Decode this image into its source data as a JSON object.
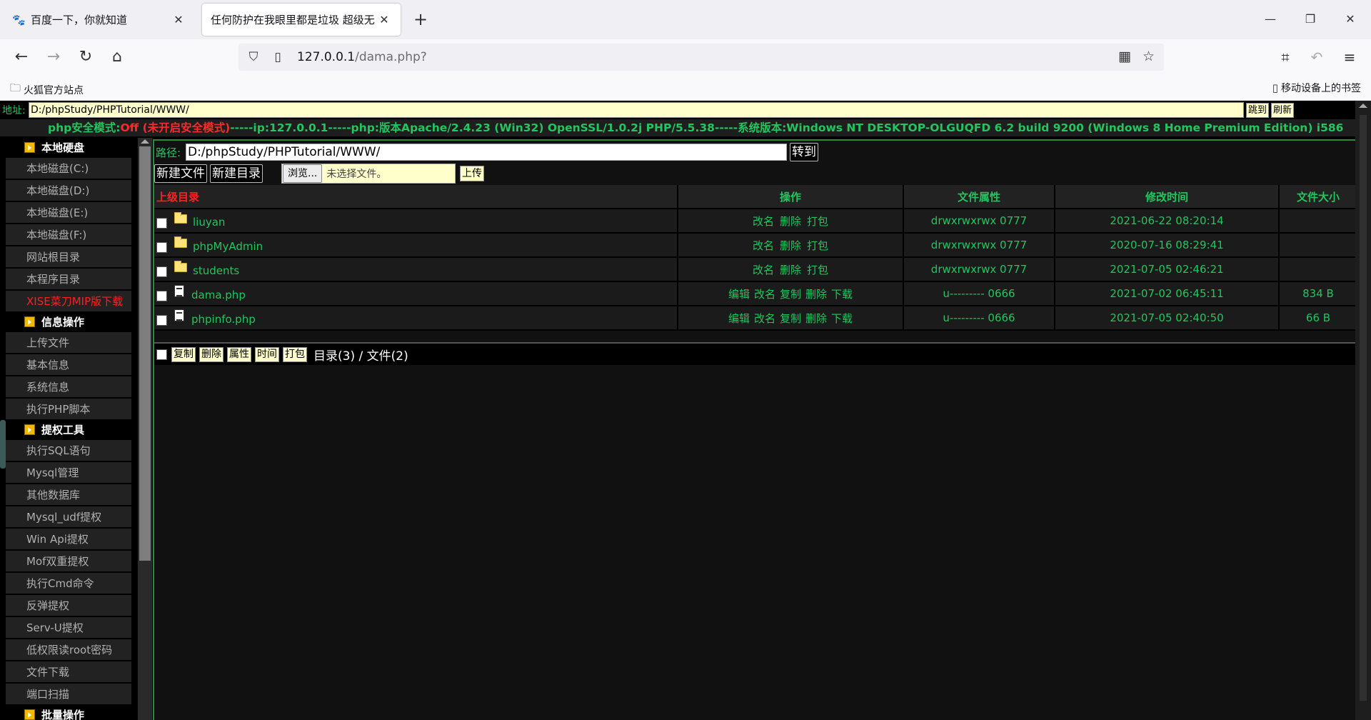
{
  "browser": {
    "tabs": [
      {
        "title": "百度一下，你就知道",
        "close": "✕"
      },
      {
        "title": "任何防护在我眼里都是垃圾 超级无",
        "close": "✕"
      }
    ],
    "new_tab": "+",
    "url_host": "127.0.0.1",
    "url_path": "/dama.php?",
    "bookmark_left": "火狐官方站点",
    "bookmark_right": "移动设备上的书签"
  },
  "page": {
    "addr_label": "地址:",
    "addr_value": "D:/phpStudy/PHPTutorial/WWW/",
    "btn_jump": "跳到",
    "btn_refresh": "刷新",
    "info": {
      "safe_label": "php安全模式:",
      "safe_value": "Off (未开启安全模式)",
      "rest": "-----ip:127.0.0.1-----php:版本Apache/2.4.23 (Win32) OpenSSL/1.0.2j PHP/5.5.38-----系统版本:Windows NT DESKTOP-OLGUQFD 6.2 build 9200 (Windows 8 Home Premium Edition) i586"
    },
    "sidebar": {
      "sections": [
        {
          "title": "本地硬盘",
          "items": [
            "本地磁盘(C:)",
            "本地磁盘(D:)",
            "本地磁盘(E:)",
            "本地磁盘(F:)",
            "网站根目录",
            "本程序目录",
            "XISE菜刀MIP版下载"
          ]
        },
        {
          "title": "信息操作",
          "items": [
            "上传文件",
            "基本信息",
            "系统信息",
            "执行PHP脚本"
          ]
        },
        {
          "title": "提权工具",
          "items": [
            "执行SQL语句",
            "Mysql管理",
            "其他数据库",
            "Mysql_udf提权",
            "Win Api提权",
            "Mof双重提权",
            "执行Cmd命令",
            "反弹提权",
            "Serv-U提权",
            "低权限读root密码",
            "文件下载",
            "端口扫描"
          ]
        },
        {
          "title": "批量操作",
          "items": []
        }
      ]
    },
    "path_label": "路径:",
    "path_value": "D:/phpStudy/PHPTutorial/WWW/",
    "btn_go": "转到",
    "btn_new_file": "新建文件",
    "btn_new_dir": "新建目录",
    "browse": "浏览...",
    "no_file": "未选择文件。",
    "btn_upload": "上传",
    "table": {
      "headers": [
        "上级目录",
        "操作",
        "文件属性",
        "修改时间",
        "文件大小"
      ],
      "rows": [
        {
          "name": "liuyan",
          "type": "dir",
          "ops": [
            "改名",
            "删除",
            "打包"
          ],
          "perm": "drwxrwxrwx 0777",
          "mtime": "2021-06-22 08:20:14",
          "size": ""
        },
        {
          "name": "phpMyAdmin",
          "type": "dir",
          "ops": [
            "改名",
            "删除",
            "打包"
          ],
          "perm": "drwxrwxrwx 0777",
          "mtime": "2020-07-16 08:29:41",
          "size": ""
        },
        {
          "name": "students",
          "type": "dir",
          "ops": [
            "改名",
            "删除",
            "打包"
          ],
          "perm": "drwxrwxrwx 0777",
          "mtime": "2021-07-05 02:46:21",
          "size": ""
        },
        {
          "name": "dama.php",
          "type": "file",
          "ops": [
            "编辑",
            "改名",
            "复制",
            "删除",
            "下载"
          ],
          "perm": "u--------- 0666",
          "mtime": "2021-07-02 06:45:11",
          "size": "834 B"
        },
        {
          "name": "phpinfo.php",
          "type": "file",
          "ops": [
            "编辑",
            "改名",
            "复制",
            "删除",
            "下载"
          ],
          "perm": "u--------- 0666",
          "mtime": "2021-07-05 02:40:50",
          "size": "66 B"
        }
      ]
    },
    "footer_buttons": [
      "复制",
      "删除",
      "属性",
      "时间",
      "打包"
    ],
    "count_text": "目录(3) / 文件(2)"
  }
}
